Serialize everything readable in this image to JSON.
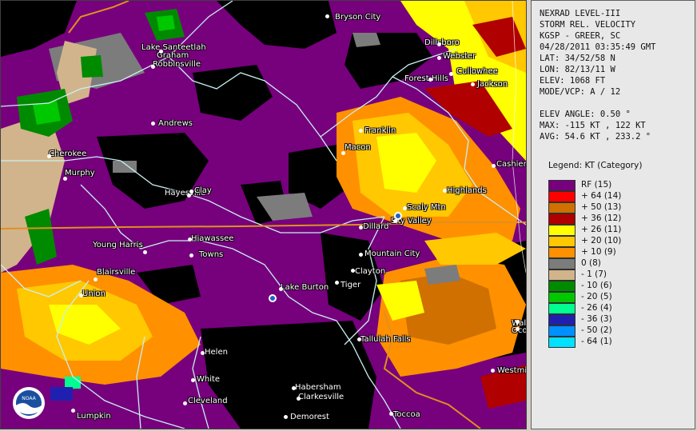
{
  "info": {
    "lines_top": [
      "NEXRAD LEVEL-III",
      "STORM REL. VELOCITY",
      "KGSP - GREER, SC",
      "04/28/2011 03:35:49 GMT",
      "LAT: 34/52/58 N",
      "LON: 82/13/11 W",
      "ELEV: 1068 FT",
      "MODE/VCP: A / 12"
    ],
    "lines_bottom": [
      "ELEV ANGLE: 0.50 °",
      "MAX: -115 KT , 122 KT",
      "AVG: 54.6 KT , 233.2 °"
    ]
  },
  "legend": {
    "title": "Legend: KT (Category)",
    "items": [
      {
        "label": "RF  (15)",
        "color": "#77007d"
      },
      {
        "label": "+ 64  (14)",
        "color": "#ff0000"
      },
      {
        "label": "+ 50  (13)",
        "color": "#d07000"
      },
      {
        "label": "+ 36  (12)",
        "color": "#b00000"
      },
      {
        "label": "+ 26  (11)",
        "color": "#ffff00"
      },
      {
        "label": "+ 20  (10)",
        "color": "#ffc800"
      },
      {
        "label": "+ 10  (9)",
        "color": "#ff9000"
      },
      {
        "label": "0  (8)",
        "color": "#7c7c7c"
      },
      {
        "label": "- 1  (7)",
        "color": "#d2b48c"
      },
      {
        "label": "- 10  (6)",
        "color": "#008a00"
      },
      {
        "label": "- 20  (5)",
        "color": "#00c800"
      },
      {
        "label": "- 26  (4)",
        "color": "#00ff90"
      },
      {
        "label": "- 36  (3)",
        "color": "#2020b0"
      },
      {
        "label": "- 50  (2)",
        "color": "#0090ff"
      },
      {
        "label": "- 64  (1)",
        "color": "#00e0ff"
      }
    ]
  },
  "places": [
    {
      "name": "Bryson City"
    },
    {
      "name": "Dillsboro"
    },
    {
      "name": "Webster"
    },
    {
      "name": "Forest Hills"
    },
    {
      "name": "Cullowhee"
    },
    {
      "name": "Jackson"
    },
    {
      "name": "Lake Santeetlah"
    },
    {
      "name": "Graham"
    },
    {
      "name": "Robbinsville"
    },
    {
      "name": "Andrews"
    },
    {
      "name": "Franklin"
    },
    {
      "name": "Macon"
    },
    {
      "name": "Cherokee"
    },
    {
      "name": "Murphy"
    },
    {
      "name": "Cashiers"
    },
    {
      "name": "Hayesville"
    },
    {
      "name": "Clay"
    },
    {
      "name": "Highlands"
    },
    {
      "name": "Scaly Mtn"
    },
    {
      "name": "Sky Valley"
    },
    {
      "name": "Dillard"
    },
    {
      "name": "Hiawassee"
    },
    {
      "name": "Young Harris"
    },
    {
      "name": "Towns"
    },
    {
      "name": "Mountain City"
    },
    {
      "name": "Clayton"
    },
    {
      "name": "Blairsville"
    },
    {
      "name": "Lake Burton"
    },
    {
      "name": "Tiger"
    },
    {
      "name": "Union"
    },
    {
      "name": "Tallulah Falls"
    },
    {
      "name": "Helen"
    },
    {
      "name": "White"
    },
    {
      "name": "Habersham"
    },
    {
      "name": "Clarkesville"
    },
    {
      "name": "Cleveland"
    },
    {
      "name": "Demorest"
    },
    {
      "name": "Toccoa"
    },
    {
      "name": "Lumpkin"
    },
    {
      "name": "Westmi"
    },
    {
      "name": "Wal"
    },
    {
      "name": "Oco"
    }
  ],
  "logo_text": "NOAA"
}
